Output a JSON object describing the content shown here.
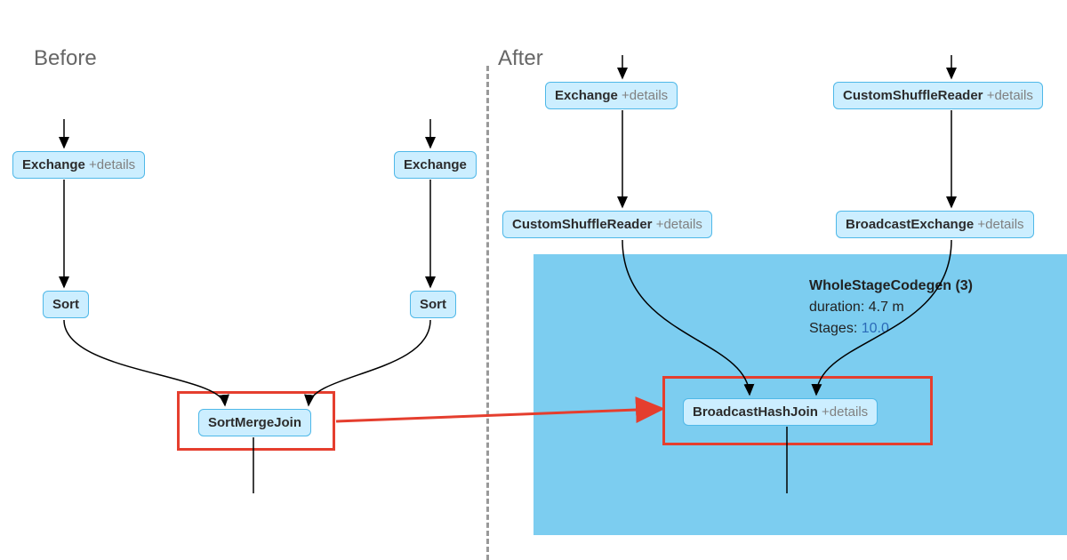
{
  "headings": {
    "before": "Before",
    "after": "After"
  },
  "before": {
    "exchange_left": {
      "label": "Exchange",
      "details": "+details"
    },
    "exchange_right": {
      "label": "Exchange"
    },
    "sort_left": {
      "label": "Sort"
    },
    "sort_right": {
      "label": "Sort"
    },
    "join": {
      "label": "SortMergeJoin"
    }
  },
  "after": {
    "exchange": {
      "label": "Exchange",
      "details": "+details"
    },
    "csr_top": {
      "label": "CustomShuffleReader",
      "details": "+details"
    },
    "csr_mid": {
      "label": "CustomShuffleReader",
      "details": "+details"
    },
    "bcast_exchange": {
      "label": "BroadcastExchange",
      "details": "+details"
    },
    "stage": {
      "title": "WholeStageCodegen (3)",
      "duration_label": "duration:",
      "duration": "4.7 m",
      "stages_label": "Stages:",
      "stages": "10.0"
    },
    "join": {
      "label": "BroadcastHashJoin",
      "details": "+details"
    }
  }
}
